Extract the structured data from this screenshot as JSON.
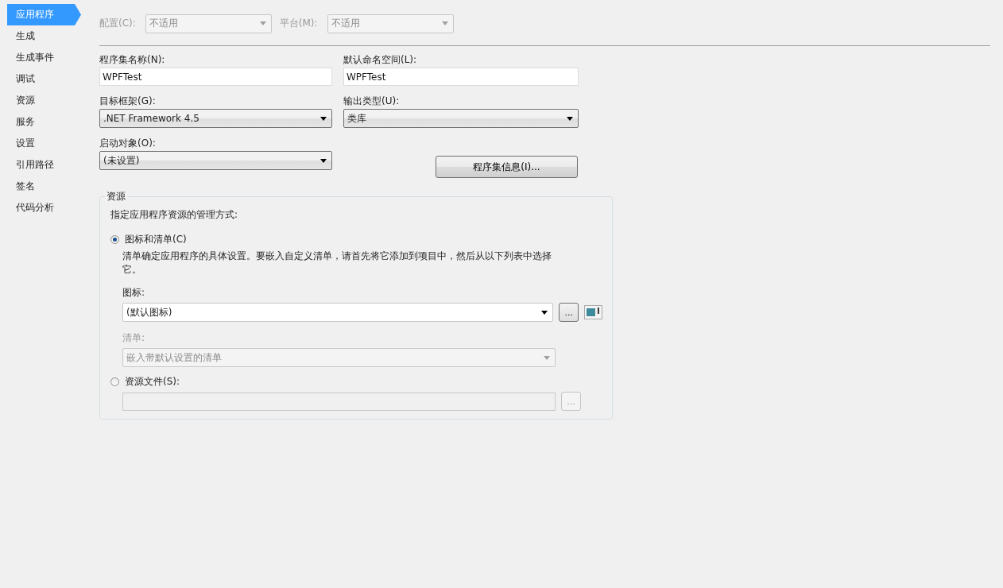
{
  "sidebar": {
    "items": [
      {
        "label": "应用程序",
        "selected": true
      },
      {
        "label": "生成",
        "selected": false
      },
      {
        "label": "生成事件",
        "selected": false
      },
      {
        "label": "调试",
        "selected": false
      },
      {
        "label": "资源",
        "selected": false
      },
      {
        "label": "服务",
        "selected": false
      },
      {
        "label": "设置",
        "selected": false
      },
      {
        "label": "引用路径",
        "selected": false
      },
      {
        "label": "签名",
        "selected": false
      },
      {
        "label": "代码分析",
        "selected": false
      }
    ]
  },
  "top_bar": {
    "configuration": {
      "label": "配置(C):",
      "value": "不适用",
      "disabled": true
    },
    "platform": {
      "label": "平台(M):",
      "value": "不适用",
      "disabled": true
    }
  },
  "assembly_name": {
    "label": "程序集名称(N):",
    "value": "WPFTest"
  },
  "default_namespace": {
    "label": "默认命名空间(L):",
    "value": "WPFTest"
  },
  "target_framework": {
    "label": "目标框架(G):",
    "value": ".NET Framework 4.5"
  },
  "output_type": {
    "label": "输出类型(U):",
    "value": "类库"
  },
  "startup_object": {
    "label": "启动对象(O):",
    "value": "(未设置)"
  },
  "assembly_info_button": "程序集信息(I)...",
  "resources": {
    "title": "资源",
    "description": "指定应用程序资源的管理方式:",
    "icon_manifest": {
      "label": "图标和清单(C)",
      "selected": true,
      "help": "清单确定应用程序的具体设置。要嵌入自定义清单，请首先将它添加到项目中，然后从以下列表中选择它。",
      "icon_label": "图标:",
      "icon_value": "(默认图标)",
      "browse": "...",
      "manifest_label": "清单:",
      "manifest_value": "嵌入带默认设置的清单",
      "manifest_disabled": true
    },
    "resource_file": {
      "label": "资源文件(S):",
      "selected": false,
      "browse": "...",
      "disabled": true
    }
  }
}
